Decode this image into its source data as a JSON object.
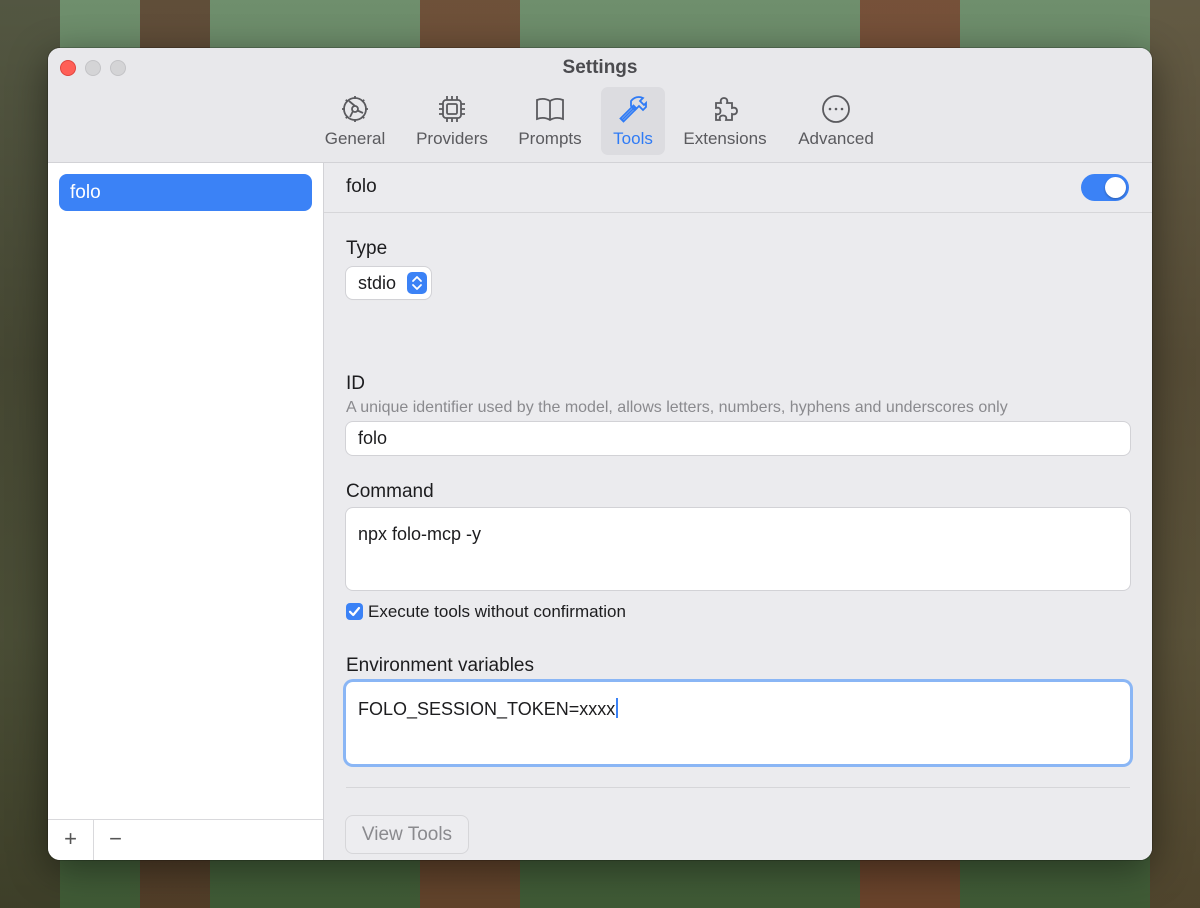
{
  "window": {
    "title": "Settings"
  },
  "toolbar": {
    "items": [
      {
        "label": "General",
        "icon": "gear-icon",
        "active": false
      },
      {
        "label": "Providers",
        "icon": "chip-icon",
        "active": false
      },
      {
        "label": "Prompts",
        "icon": "book-icon",
        "active": false
      },
      {
        "label": "Tools",
        "icon": "hammer-icon",
        "active": true
      },
      {
        "label": "Extensions",
        "icon": "puzzle-icon",
        "active": false
      },
      {
        "label": "Advanced",
        "icon": "ellipsis-circle-icon",
        "active": false
      }
    ]
  },
  "sidebar": {
    "items": [
      {
        "label": "folo",
        "selected": true
      }
    ],
    "add_label": "+",
    "remove_label": "−"
  },
  "detail": {
    "title": "folo",
    "enabled": true,
    "type": {
      "label": "Type",
      "value": "stdio"
    },
    "id": {
      "label": "ID",
      "description": "A unique identifier used by the model, allows letters, numbers, hyphens and underscores only",
      "value": "folo"
    },
    "command": {
      "label": "Command",
      "value": "npx folo-mcp -y"
    },
    "auto_execute": {
      "label": "Execute tools without confirmation",
      "checked": true
    },
    "env": {
      "label": "Environment variables",
      "value": "FOLO_SESSION_TOKEN=xxxx"
    },
    "view_tools_label": "View Tools"
  },
  "colors": {
    "accent": "#3b82f6",
    "close": "#ff5f57"
  }
}
